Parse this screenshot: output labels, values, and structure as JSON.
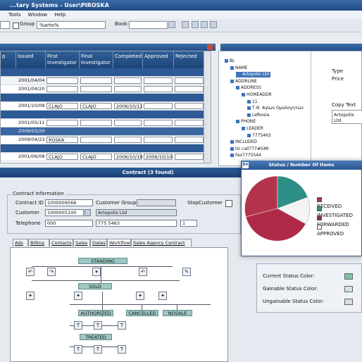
{
  "window": {
    "title": "...tary Systems - User\\PIROSKA"
  },
  "menu": [
    "Tools",
    "Window",
    "Help"
  ],
  "toolbar": {
    "group_label": "Group",
    "search_value": "%arto%",
    "book_label": "Book:",
    "book_value": ""
  },
  "grid": {
    "columns": [
      "p",
      "Issued",
      "First Investigator",
      "Final Investigator",
      "Completed",
      "Approved",
      "Rejected"
    ],
    "rows": [
      {
        "style": "band",
        "cells": [
          "",
          "",
          "",
          "",
          "",
          "",
          ""
        ]
      },
      {
        "style": "normal",
        "cells": [
          "",
          "2001/04/04",
          "",
          "",
          "",
          "",
          ""
        ]
      },
      {
        "style": "normal",
        "cells": [
          "",
          "2001/04/20",
          "",
          "",
          "",
          "",
          ""
        ]
      },
      {
        "style": "band",
        "cells": [
          "",
          "",
          "",
          "",
          "",
          "",
          ""
        ]
      },
      {
        "style": "normal",
        "cells": [
          "",
          "2001/10/09",
          "CLAJO",
          "CLAJO",
          "2006/10/11",
          "",
          ""
        ]
      },
      {
        "style": "band",
        "cells": [
          "",
          "",
          "",
          "",
          "",
          "",
          ""
        ]
      },
      {
        "style": "normal",
        "cells": [
          "",
          "2001/05/11",
          "",
          "",
          "",
          "",
          ""
        ]
      },
      {
        "style": "sel",
        "cells": [
          "",
          "2009/03/20",
          "",
          "",
          "",
          "",
          ""
        ]
      },
      {
        "style": "normal",
        "cells": [
          "",
          "2009/04/23",
          "ROSKA",
          "",
          "",
          "",
          ""
        ]
      },
      {
        "style": "band",
        "cells": [
          "",
          "",
          "",
          "",
          "",
          "",
          ""
        ]
      },
      {
        "style": "normal",
        "cells": [
          "",
          "2001/06/08",
          "CLAJO",
          "CLAJO",
          "2006/10/10",
          "2006/10/10",
          ""
        ]
      }
    ]
  },
  "tree": [
    {
      "label": "BL",
      "indent": 0,
      "hl": false
    },
    {
      "label": "NAME",
      "indent": 1,
      "hl": false
    },
    {
      "label": "Artopolis Ltd",
      "indent": 2,
      "hl": true
    },
    {
      "label": "ADDRLINE",
      "indent": 1,
      "hl": false
    },
    {
      "label": "ADDRESS",
      "indent": 2,
      "hl": false
    },
    {
      "label": "HOMEADDR",
      "indent": 3,
      "hl": false
    },
    {
      "label": "11",
      "indent": 4,
      "hl": false
    },
    {
      "label": "Τ.Θ. Αγίων Ομολογητών",
      "indent": 4,
      "hl": false
    },
    {
      "label": "Lefkosia",
      "indent": 4,
      "hl": false
    },
    {
      "label": "PHONE",
      "indent": 2,
      "hl": false
    },
    {
      "label": "LEADER",
      "indent": 3,
      "hl": false
    },
    {
      "label": "7775463",
      "indent": 4,
      "hl": false
    },
    {
      "label": "INCLUDED",
      "indent": 1,
      "hl": false
    },
    {
      "label": "Or call777#GMI",
      "indent": 1,
      "hl": false
    },
    {
      "label": "Fax7775544",
      "indent": 1,
      "hl": false
    }
  ],
  "right_panel": {
    "type_label": "Type",
    "price_label": "Price",
    "copy_text_label": "Copy Text",
    "copy_text_value": "Artopolis Ltd"
  },
  "contract": {
    "title": "Contract  (3 found)",
    "section_label": "Contract Information",
    "contract_id_label": "Contract ID",
    "contract_id": "1000009566",
    "customer_group_label": "Customer Group",
    "customer_group": "",
    "stop_customer_label": "StopCustomer",
    "customer_label": "Customer",
    "customer_id": "1000005100",
    "customer_name": "Artopolis Ltd",
    "telephone_label": "Telephone",
    "telephone_code": "000",
    "telephone_number": "775 5463",
    "telephone_ext": "1"
  },
  "tabs": [
    "Ads",
    "Billing",
    "Contacts",
    "Sales",
    "Dates",
    "Workflow",
    "Sales Agency Contract"
  ],
  "workflow": {
    "states": [
      "STANDING",
      "SOLD",
      "AUTHORIZED",
      "CANCELLED",
      "NOSALE",
      "TREATED"
    ]
  },
  "status_window": {
    "title": "Status / Number Of Items",
    "legend": [
      {
        "label": "RECEIVED",
        "color": "#b2334a"
      },
      {
        "label": "INVESTIGATED",
        "color": "#2e8f86"
      },
      {
        "label": "FORWARDED",
        "color": "#8a2c5c"
      },
      {
        "label": "APPROVED",
        "color": "#f4f4f4"
      }
    ]
  },
  "status_colors": {
    "current_label": "Current Status Color:",
    "current_color": "#7fbfa8",
    "gainable_label": "Gainable Status Color:",
    "gainable_color": "#cfe3dc",
    "ungainable_label": "Ungainable Status Color:",
    "ungainable_color": "#d8dcdf"
  }
}
